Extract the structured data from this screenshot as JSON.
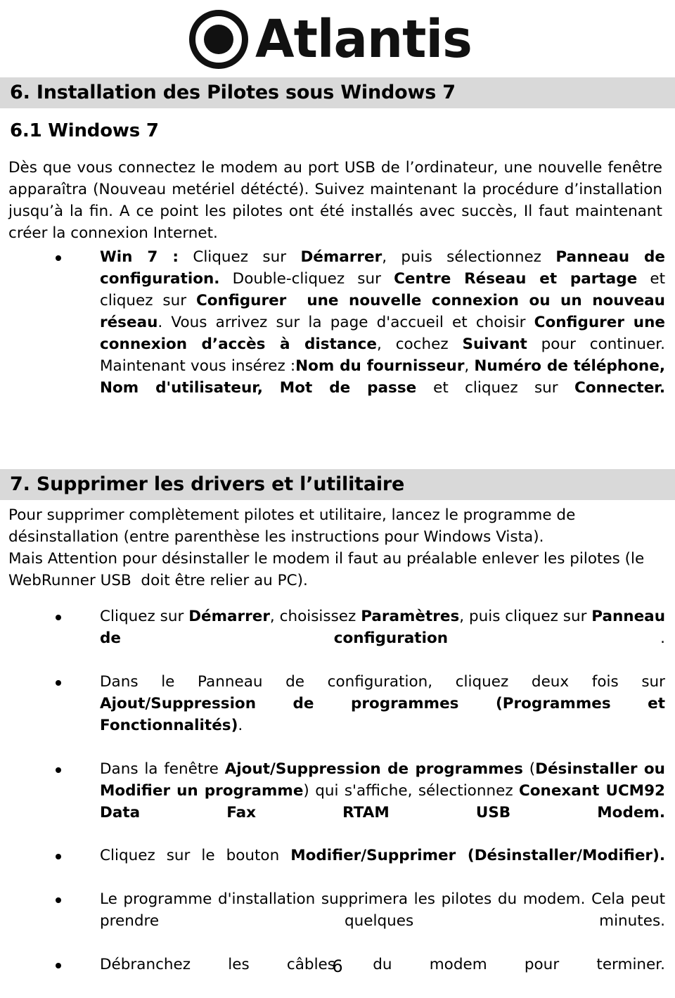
{
  "brand": {
    "name": "Atlantis",
    "mark": "circle-dot-logo"
  },
  "sections": [
    {
      "id": "section6",
      "heading": "6. Installation des Pilotes sous Windows 7",
      "subheading": "6.1 Windows 7",
      "paragraph_html": "Dès que vous connectez le modem au port USB de l’ordinateur, une nouvelle fenêtre apparaîtra (Nouveau metériel détécté). Suivez maintenant la procédure d’installation jusqu’à la fin. A ce point les pilotes ont été installés avec succès, Il faut maintenant créer la connexion Internet.",
      "bullets_html": [
        "<b>Win 7 :</b> Cliquez sur <b>Démarrer</b>, puis sélectionnez <b>Panneau de configuration.</b> Double-cliquez sur <b>Centre Réseau et partage</b> et cliquez sur <b>Configurer&nbsp; une nouvelle connexion ou un nouveau réseau</b>. Vous arrivez sur la page d'accueil et choisir <b>Configurer une connexion d’accès à distance</b>, cochez <b>Suivant</b> pour continuer. Maintenant vous insérez :<b>Nom du fournisseur</b>, <b>Numéro de téléphone, Nom d'utilisateur, Mot de passe </b>et cliquez sur <b>Connecter.</b>"
      ]
    },
    {
      "id": "section7",
      "heading": "7. Supprimer les drivers et l’utilitaire",
      "paragraph_lines_html": [
        "Pour supprimer complètement pilotes et utilitaire, lancez le programme de désinstallation (entre parenthèse les instructions pour Windows Vista).",
        "Mais Attention pour désinstaller le modem il faut au préalable enlever les pilotes (le WebRunner USB&nbsp; doit être relier au PC)."
      ],
      "bullets_html": [
        "Cliquez sur <b>Démarrer</b>, choisissez <b>Paramètres</b>, puis cliquez sur <b>Panneau de configuration</b> .",
        "Dans le Panneau de configuration, cliquez deux fois sur <b>Ajout/Suppression de programmes (Programmes et Fonctionnalités)</b>.",
        "Dans la fenêtre <b>Ajout/Suppression de programmes</b> (<b>Désinstaller ou Modifier un programme</b>) qui s'affiche, sélectionnez <b>Conexant UCM92 Data Fax RTAM USB Modem.</b>",
        "Cliquez sur le bouton <b>Modifier/Supprimer (Désinstaller/Modifier).</b>",
        "Le programme d'installation supprimera les pilotes du modem. Cela peut prendre quelques minutes.",
        "Débranchez les câbles du modem pour terminer."
      ]
    }
  ],
  "footer": {
    "page_number": "6"
  },
  "colors": {
    "heading_band": "#d9d9d9",
    "text": "#000000",
    "page_background": "#ffffff"
  }
}
